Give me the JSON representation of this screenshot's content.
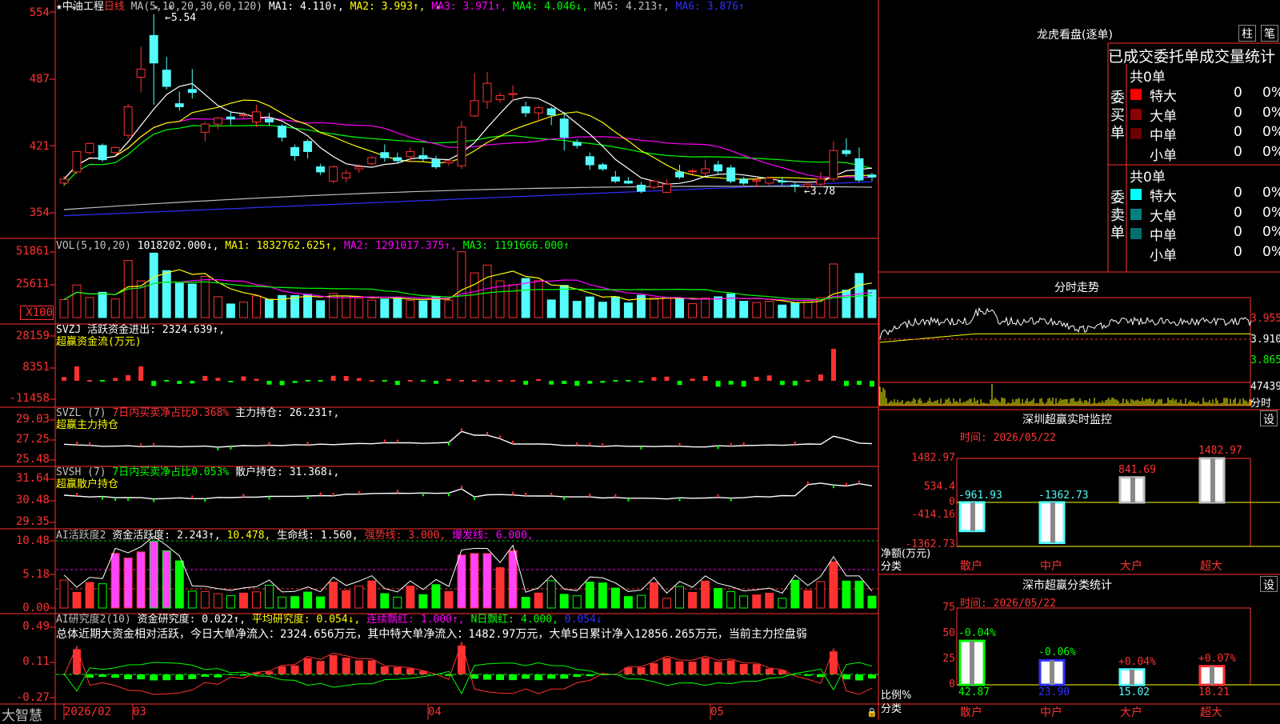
{
  "stock": {
    "name": "中油工程",
    "period": "日线",
    "max_label": "←5.54",
    "min_label": "←3.78"
  },
  "ma_header": [
    {
      "t": "MA(5,10,20,30,60,120)",
      "c": "#c0c0c0"
    },
    {
      "t": "MA1: 4.110↑,",
      "c": "#ffffff"
    },
    {
      "t": "MA2: 3.993↑,",
      "c": "#ffff00"
    },
    {
      "t": "MA3: 3.971↑,",
      "c": "#ff00ff"
    },
    {
      "t": "MA4: 4.046↓,",
      "c": "#00ff00"
    },
    {
      "t": "MA5: 4.213↑,",
      "c": "#c0c0c0"
    },
    {
      "t": "MA6: 3.876↑",
      "c": "#3030ff"
    }
  ],
  "price_axis": [
    "554",
    "487",
    "421",
    "354"
  ],
  "vol_header": [
    {
      "t": "VOL(5,10,20)",
      "c": "#c0c0c0"
    },
    {
      "t": "1018202.000↓,",
      "c": "#ffffff"
    },
    {
      "t": "MA1: 1832762.625↑,",
      "c": "#ffff00"
    },
    {
      "t": "MA2: 1291017.375↑,",
      "c": "#ff00ff"
    },
    {
      "t": "MA3: 1191666.000↑",
      "c": "#00ff00"
    }
  ],
  "vol_axis": [
    "51861",
    "25611",
    "X100"
  ],
  "svzj": {
    "header": [
      {
        "t": "SVZJ  活跃资金进出: 2324.639↑,",
        "c": "#ffffff"
      }
    ],
    "sub": "超赢资金流(万元)",
    "axis": [
      "28159",
      "8351",
      "-11458"
    ]
  },
  "svzl": {
    "header": [
      {
        "t": "SVZL (7)",
        "c": "#c0c0c0"
      },
      {
        "t": "7日内买卖净占比0.368%",
        "c": "#ff3232"
      },
      {
        "t": "主力持仓: 26.231↑,",
        "c": "#ffffff"
      }
    ],
    "sub": "超赢主力持仓",
    "axis": [
      "29.03",
      "27.25",
      "25.48"
    ]
  },
  "svsh": {
    "header": [
      {
        "t": "SVSH (7)",
        "c": "#c0c0c0"
      },
      {
        "t": "7日内买卖净占比0.053%",
        "c": "#00ff00"
      },
      {
        "t": "散户持仓: 31.368↓,",
        "c": "#ffffff"
      }
    ],
    "sub": "超赢散户持仓",
    "axis": [
      "31.64",
      "30.48",
      "29.35"
    ]
  },
  "ai_active": {
    "header": [
      {
        "t": "AI活跃度2",
        "c": "#c0c0c0"
      },
      {
        "t": "资金活跃度: 2.243↑,",
        "c": "#ffffff"
      },
      {
        "t": "10.478,",
        "c": "#ffff00"
      },
      {
        "t": "生命线: 1.560,",
        "c": "#ffffff"
      },
      {
        "t": "强势线: 3.000,",
        "c": "#ff3232"
      },
      {
        "t": "爆发线: 6.000,",
        "c": "#ff00ff"
      }
    ],
    "axis": [
      "10.48",
      "5.18",
      "0.00"
    ]
  },
  "ai_research": {
    "header": [
      {
        "t": "AI研究度2(10)",
        "c": "#c0c0c0"
      },
      {
        "t": "资金研究度: 0.022↑,",
        "c": "#ffffff"
      },
      {
        "t": "平均研究度: 0.054↓,",
        "c": "#ffff00"
      },
      {
        "t": "连续飘红: 1.000↑,",
        "c": "#ff00ff"
      },
      {
        "t": "N日飘红: 4.000,",
        "c": "#00ff00"
      },
      {
        "t": "0.054↓",
        "c": "#3030ff"
      }
    ],
    "summary": "总体近期大资金相对活跃，今日大单净流入：2324.656万元，其中特大单净流入：1482.97万元，大单5日累计净入12856.265万元，当前主力控盘弱",
    "axis": [
      "0.49",
      "0.11",
      "-0.27"
    ]
  },
  "time_axis": {
    "logo": "大智慧",
    "labels": [
      "2026/02",
      "03",
      "04",
      "05"
    ]
  },
  "right": {
    "tabs": [
      "柱",
      "笔"
    ],
    "dragon_title": "龙虎看盘(逐单)",
    "order_tabs": "已成交委托单成交量统计",
    "buy": {
      "label": "委买单",
      "total": "共0单",
      "rows": [
        {
          "name": "特大",
          "n": "0",
          "p": "0%",
          "color": "#ff0000"
        },
        {
          "name": "大单",
          "n": "0",
          "p": "0%",
          "color": "#8b0000"
        },
        {
          "name": "中单",
          "n": "0",
          "p": "0%",
          "color": "#6a0000"
        },
        {
          "name": "小单",
          "n": "0",
          "p": "0%",
          "color": ""
        }
      ]
    },
    "sell": {
      "label": "委卖单",
      "total": "共0单",
      "rows": [
        {
          "name": "特大",
          "n": "0",
          "p": "0%",
          "color": "#00ffff"
        },
        {
          "name": "大单",
          "n": "0",
          "p": "0%",
          "color": "#008080"
        },
        {
          "name": "中单",
          "n": "0",
          "p": "0%",
          "color": "#006f6f"
        },
        {
          "name": "小单",
          "n": "0",
          "p": "0%",
          "color": ""
        }
      ]
    },
    "intraday": {
      "title": "分时走势",
      "axis": [
        "3.955",
        "3.910",
        "3.865"
      ],
      "vol": "47439",
      "vol_unit": "分时"
    },
    "monitor": {
      "title": "深圳超赢实时监控",
      "set": "设",
      "time": "时间: 2026/05/22",
      "axis": [
        "1482.97",
        "534.4",
        "0",
        "-414.16",
        "-1362.73"
      ],
      "unit": "净额(万元)",
      "cat_label": "分类",
      "bars": [
        {
          "cat": "散户",
          "value": "-961.93"
        },
        {
          "cat": "中户",
          "value": "-1362.73"
        },
        {
          "cat": "大户",
          "value": "841.69"
        },
        {
          "cat": "超大",
          "value": "1482.97"
        }
      ]
    },
    "stats": {
      "title": "深市超赢分类统计",
      "set": "设",
      "time": "时间: 2026/05/22",
      "axis": [
        "75",
        "50",
        "25",
        "0"
      ],
      "unit": "比例%",
      "cat_label": "分类",
      "bars": [
        {
          "cat": "散户",
          "value": "42.87",
          "delta": "-0.04%"
        },
        {
          "cat": "中户",
          "value": "23.90",
          "delta": "-0.06%"
        },
        {
          "cat": "大户",
          "value": "15.02",
          "delta": "+0.04%"
        },
        {
          "cat": "超大",
          "value": "18.21",
          "delta": "+0.07%"
        }
      ]
    }
  },
  "chart_data": {
    "type": "candlestick",
    "ylim": [
      3.4,
      5.6
    ],
    "candles": [
      [
        3.88,
        3.95,
        3.85,
        3.92
      ],
      [
        3.99,
        4.19,
        3.97,
        4.19
      ],
      [
        4.18,
        4.28,
        4.16,
        4.27
      ],
      [
        4.25,
        4.27,
        4.09,
        4.11
      ],
      [
        4.18,
        4.24,
        4.16,
        4.23
      ],
      [
        4.35,
        4.66,
        4.32,
        4.63
      ],
      [
        4.92,
        5.22,
        4.77,
        5.0
      ],
      [
        5.33,
        5.54,
        4.65,
        5.06
      ],
      [
        4.99,
        5.12,
        4.8,
        4.83
      ],
      [
        4.66,
        4.78,
        4.59,
        4.63
      ],
      [
        4.8,
        5.0,
        4.71,
        4.77
      ],
      [
        4.38,
        4.48,
        4.29,
        4.46
      ],
      [
        4.46,
        4.53,
        4.41,
        4.52
      ],
      [
        4.53,
        4.59,
        4.45,
        4.51
      ],
      [
        4.54,
        4.58,
        4.52,
        4.55
      ],
      [
        4.48,
        4.65,
        4.43,
        4.58
      ],
      [
        4.51,
        4.57,
        4.44,
        4.48
      ],
      [
        4.44,
        4.46,
        4.29,
        4.33
      ],
      [
        4.23,
        4.26,
        4.1,
        4.15
      ],
      [
        4.29,
        4.31,
        4.12,
        4.19
      ],
      [
        4.04,
        4.07,
        3.96,
        3.99
      ],
      [
        3.9,
        4.05,
        3.88,
        4.04
      ],
      [
        3.93,
        4.01,
        3.89,
        3.98
      ],
      [
        4.02,
        4.07,
        3.98,
        4.04
      ],
      [
        4.07,
        4.15,
        4.05,
        4.13
      ],
      [
        4.18,
        4.26,
        4.09,
        4.13
      ],
      [
        4.13,
        4.18,
        4.07,
        4.1
      ],
      [
        4.14,
        4.23,
        4.08,
        4.19
      ],
      [
        4.15,
        4.23,
        4.09,
        4.12
      ],
      [
        4.11,
        4.15,
        4.02,
        4.04
      ],
      [
        4.08,
        4.11,
        4.05,
        4.1
      ],
      [
        4.05,
        4.49,
        4.02,
        4.43
      ],
      [
        4.54,
        4.96,
        4.53,
        4.69
      ],
      [
        4.68,
        4.97,
        4.61,
        4.86
      ],
      [
        4.7,
        4.77,
        4.67,
        4.74
      ],
      [
        4.75,
        4.84,
        4.69,
        4.76
      ],
      [
        4.63,
        4.68,
        4.53,
        4.57
      ],
      [
        4.57,
        4.64,
        4.48,
        4.62
      ],
      [
        4.61,
        4.63,
        4.45,
        4.55
      ],
      [
        4.51,
        4.58,
        4.2,
        4.33
      ],
      [
        4.28,
        4.31,
        4.22,
        4.25
      ],
      [
        4.14,
        4.18,
        4.01,
        4.06
      ],
      [
        4.06,
        4.08,
        4.0,
        4.02
      ],
      [
        3.94,
        4.0,
        3.88,
        3.9
      ],
      [
        3.9,
        3.94,
        3.87,
        3.88
      ],
      [
        3.86,
        3.89,
        3.78,
        3.8
      ],
      [
        3.84,
        3.91,
        3.82,
        3.9
      ],
      [
        3.79,
        3.92,
        3.78,
        3.87
      ],
      [
        3.99,
        4.06,
        3.92,
        3.94
      ],
      [
        4.0,
        4.02,
        3.97,
        4.0
      ],
      [
        3.98,
        4.11,
        3.95,
        4.02
      ],
      [
        4.06,
        4.1,
        3.97,
        4.0
      ],
      [
        4.03,
        4.06,
        3.88,
        3.9
      ],
      [
        3.92,
        3.94,
        3.86,
        3.88
      ],
      [
        3.9,
        3.93,
        3.84,
        3.91
      ],
      [
        3.88,
        3.94,
        3.86,
        3.93
      ],
      [
        3.9,
        3.94,
        3.86,
        3.89
      ],
      [
        3.86,
        3.89,
        3.79,
        3.85
      ],
      [
        3.85,
        3.89,
        3.82,
        3.87
      ],
      [
        3.87,
        3.99,
        3.85,
        3.92
      ],
      [
        3.92,
        4.29,
        3.89,
        4.2
      ],
      [
        4.2,
        4.32,
        4.14,
        4.17
      ],
      [
        4.12,
        4.23,
        3.89,
        3.91
      ],
      [
        3.96,
        3.98,
        3.9,
        3.94
      ]
    ]
  }
}
